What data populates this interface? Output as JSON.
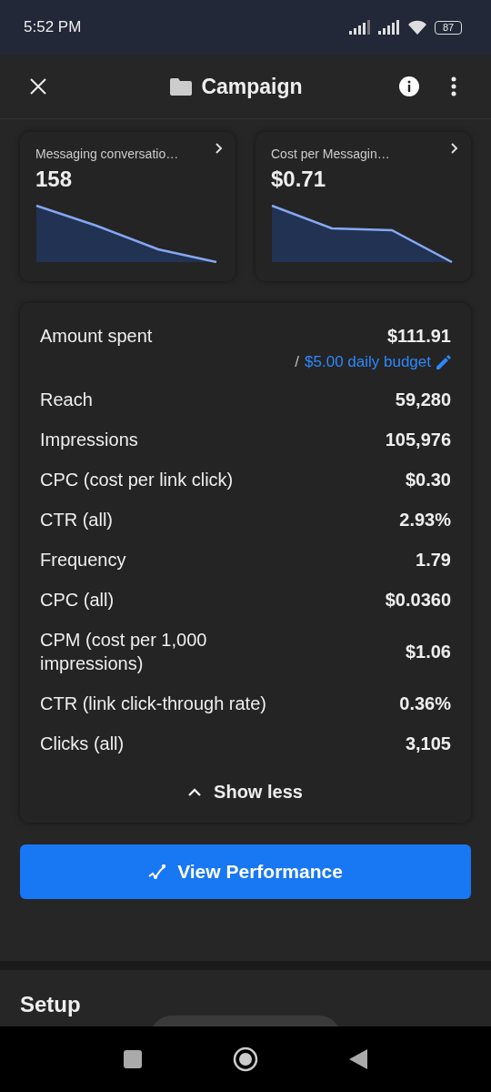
{
  "status_bar": {
    "time": "5:52 PM",
    "battery": "87"
  },
  "header": {
    "title": "Campaign"
  },
  "summary_cards": [
    {
      "title": "Messaging conversatio…",
      "value": "158"
    },
    {
      "title": "Cost per Messagin…",
      "value": "$0.71"
    }
  ],
  "metrics": [
    {
      "label": "Amount spent",
      "value": "$111.91",
      "budget_separator": "/",
      "budget": "$5.00 daily budget"
    },
    {
      "label": "Reach",
      "value": "59,280"
    },
    {
      "label": "Impressions",
      "value": "105,976"
    },
    {
      "label": "CPC (cost per link click)",
      "value": "$0.30"
    },
    {
      "label": "CTR (all)",
      "value": "2.93%"
    },
    {
      "label": "Frequency",
      "value": "1.79"
    },
    {
      "label": "CPC (all)",
      "value": "$0.0360"
    },
    {
      "label": "CPM (cost per 1,000 impressions)",
      "value": "$1.06"
    },
    {
      "label": "CTR (link click-through rate)",
      "value": "0.36%"
    },
    {
      "label": "Clicks (all)",
      "value": "3,105"
    }
  ],
  "toggle": {
    "label": "Show less",
    "expanded": true
  },
  "primary_button": {
    "label": "View Performance"
  },
  "section": {
    "title": "Setup"
  }
}
